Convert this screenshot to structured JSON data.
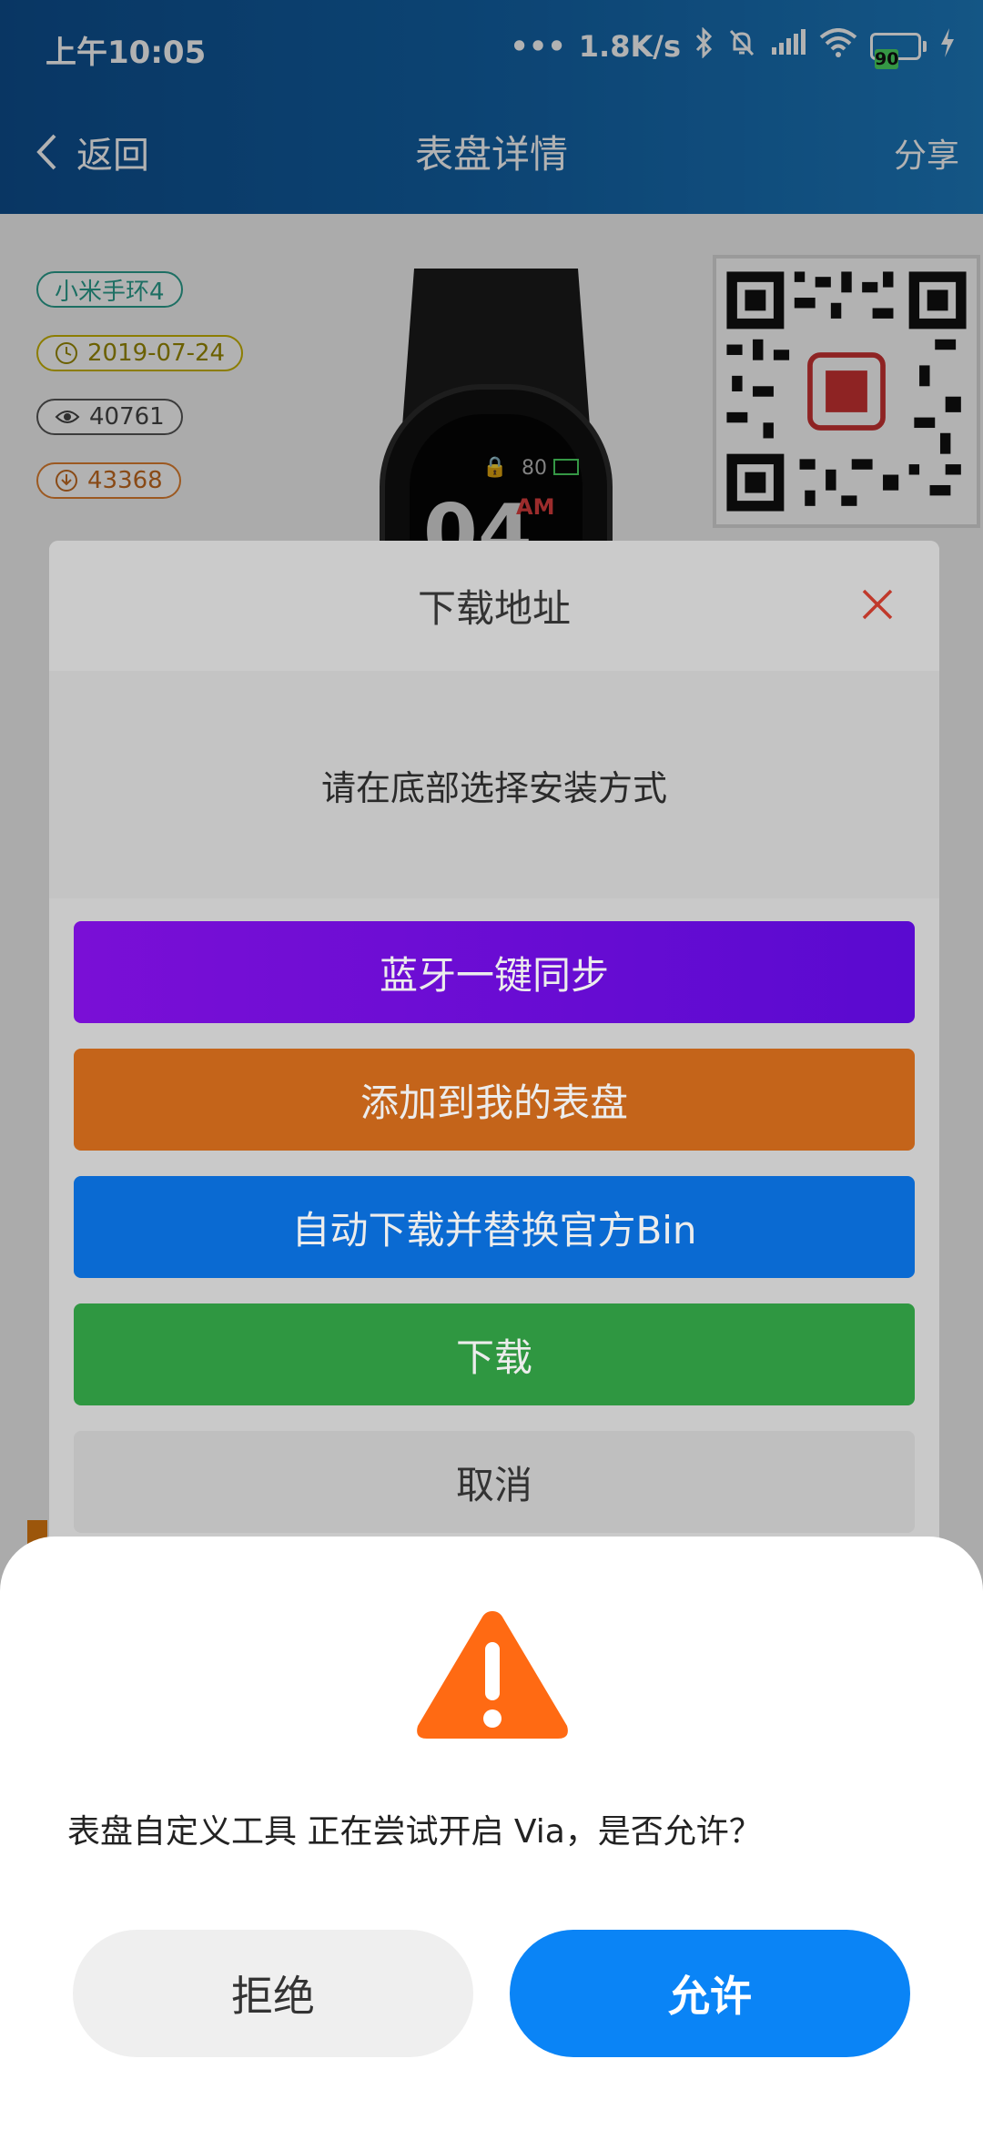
{
  "status_bar": {
    "time": "上午10:05",
    "network_speed": "1.8K/s",
    "battery_level": "90",
    "icons": [
      "more-dots-icon",
      "bluetooth-icon",
      "bell-mute-icon",
      "signal-icon",
      "wifi-icon",
      "battery-icon",
      "charging-icon"
    ]
  },
  "nav": {
    "back_label": "返回",
    "title": "表盘详情",
    "share_label": "分享"
  },
  "detail": {
    "band_tag": "小米手环4",
    "date": "2019-07-24",
    "views": "40761",
    "downloads": "43368",
    "watch_screen": {
      "digits": "04",
      "ampm": "AM",
      "battery": "80"
    }
  },
  "download_dialog": {
    "title": "下载地址",
    "message": "请在底部选择安装方式",
    "buttons": {
      "bluetooth_sync": "蓝牙一键同步",
      "add_to_faces": "添加到我的表盘",
      "auto_replace": "自动下载并替换官方Bin",
      "download": "下载",
      "cancel": "取消"
    }
  },
  "permission": {
    "message": "表盘自定义工具 正在尝试开启 Via，是否允许？",
    "deny_label": "拒绝",
    "allow_label": "允许"
  },
  "colors": {
    "header_start": "#0d4e8f",
    "header_end": "#1d7bbf",
    "bluetooth_button": "#6a0cd4",
    "add_button": "#c4641a",
    "auto_button": "#0a6ad2",
    "download_button": "#2f9741",
    "allow_button": "#0a84f6",
    "warning": "#ff6a13"
  }
}
